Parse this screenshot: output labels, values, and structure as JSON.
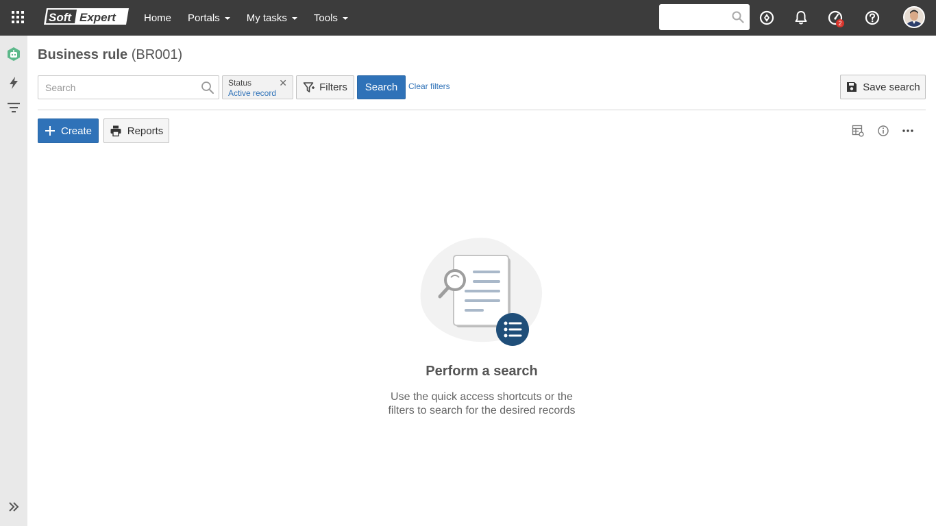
{
  "header": {
    "logo_text_left": "Soft",
    "logo_text_right": "Expert",
    "nav": [
      {
        "label": "Home",
        "dropdown": false
      },
      {
        "label": "Portals",
        "dropdown": true
      },
      {
        "label": "My tasks",
        "dropdown": true
      },
      {
        "label": "Tools",
        "dropdown": true
      }
    ],
    "search_placeholder": "",
    "notifications_badge": "2"
  },
  "page": {
    "title": "Business rule",
    "code": "(BR001)"
  },
  "search_bar": {
    "placeholder": "Search",
    "chip_label": "Status",
    "chip_value": "Active record",
    "filters_label": "Filters",
    "search_label": "Search",
    "clear_label": "Clear filters",
    "save_search_label": "Save search"
  },
  "toolbar": {
    "create_label": "Create",
    "reports_label": "Reports"
  },
  "empty_state": {
    "title": "Perform a search",
    "line1": "Use the quick access shortcuts or the",
    "line2": "filters to search for the desired records"
  },
  "colors": {
    "topbar": "#3c3c3c",
    "primary": "#2f72b8",
    "sidebar": "#e9e9e9",
    "badge": "#d9342b",
    "illustration_circle": "#1f4e79"
  },
  "icons": [
    "apps-grid-icon",
    "search-icon",
    "compass-icon",
    "bell-icon",
    "gauge-icon",
    "help-icon",
    "robot-icon",
    "lightning-icon",
    "filter-lines-icon",
    "funnel-icon",
    "plus-icon",
    "printer-icon",
    "floppy-icon",
    "table-settings-icon",
    "info-icon",
    "more-icon",
    "double-chevron-right-icon"
  ]
}
